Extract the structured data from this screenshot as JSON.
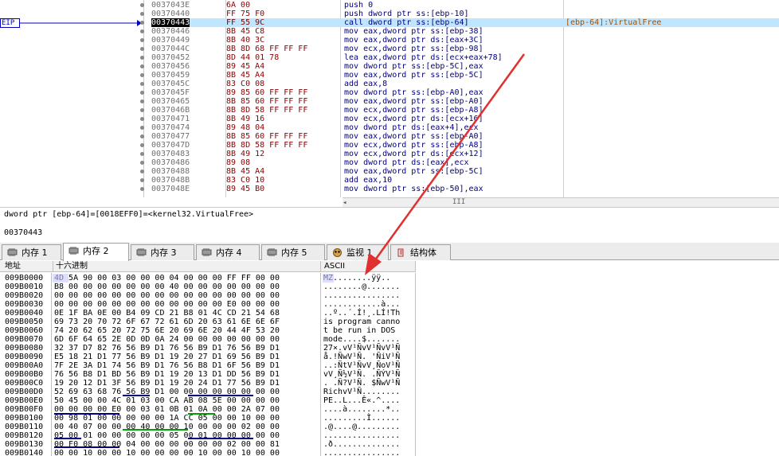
{
  "eip_label": "EIP",
  "disasm": [
    {
      "addr": "0037043E",
      "bytes": "6A 00",
      "ins": "push 0",
      "cm": ""
    },
    {
      "addr": "00370440",
      "bytes": "FF 75 F0",
      "ins": "push dword ptr ss:[ebp-10]",
      "cm": ""
    },
    {
      "addr": "00370443",
      "bytes": "FF 55 9C",
      "ins": "call dword ptr ss:[ebp-64]",
      "cm": "[ebp-64]:VirtualFree",
      "cur": true
    },
    {
      "addr": "00370446",
      "bytes": "8B 45 C8",
      "ins": "mov eax,dword ptr ss:[ebp-38]",
      "cm": ""
    },
    {
      "addr": "00370449",
      "bytes": "8B 40 3C",
      "ins": "mov eax,dword ptr ds:[eax+3C]",
      "cm": ""
    },
    {
      "addr": "0037044C",
      "bytes": "8B 8D 68 FF FF FF",
      "ins": "mov ecx,dword ptr ss:[ebp-98]",
      "cm": ""
    },
    {
      "addr": "00370452",
      "bytes": "8D 44 01 78",
      "ins": "lea eax,dword ptr ds:[ecx+eax+78]",
      "cm": ""
    },
    {
      "addr": "00370456",
      "bytes": "89 45 A4",
      "ins": "mov dword ptr ss:[ebp-5C],eax",
      "cm": ""
    },
    {
      "addr": "00370459",
      "bytes": "8B 45 A4",
      "ins": "mov eax,dword ptr ss:[ebp-5C]",
      "cm": ""
    },
    {
      "addr": "0037045C",
      "bytes": "83 C0 08",
      "ins": "add eax,8",
      "cm": ""
    },
    {
      "addr": "0037045F",
      "bytes": "89 85 60 FF FF FF",
      "ins": "mov dword ptr ss:[ebp-A0],eax",
      "cm": ""
    },
    {
      "addr": "00370465",
      "bytes": "8B 85 60 FF FF FF",
      "ins": "mov eax,dword ptr ss:[ebp-A0]",
      "cm": ""
    },
    {
      "addr": "0037046B",
      "bytes": "8B 8D 58 FF FF FF",
      "ins": "mov ecx,dword ptr ss:[ebp-A8]",
      "cm": ""
    },
    {
      "addr": "00370471",
      "bytes": "8B 49 16",
      "ins": "mov ecx,dword ptr ds:[ecx+16]",
      "cm": ""
    },
    {
      "addr": "00370474",
      "bytes": "89 48 04",
      "ins": "mov dword ptr ds:[eax+4],ecx",
      "cm": ""
    },
    {
      "addr": "00370477",
      "bytes": "8B 85 60 FF FF FF",
      "ins": "mov eax,dword ptr ss:[ebp-A0]",
      "cm": ""
    },
    {
      "addr": "0037047D",
      "bytes": "8B 8D 58 FF FF FF",
      "ins": "mov ecx,dword ptr ss:[ebp-A8]",
      "cm": ""
    },
    {
      "addr": "00370483",
      "bytes": "8B 49 12",
      "ins": "mov ecx,dword ptr ds:[ecx+12]",
      "cm": ""
    },
    {
      "addr": "00370486",
      "bytes": "89 08",
      "ins": "mov dword ptr ds:[eax],ecx",
      "cm": ""
    },
    {
      "addr": "00370488",
      "bytes": "8B 45 A4",
      "ins": "mov eax,dword ptr ss:[ebp-5C]",
      "cm": ""
    },
    {
      "addr": "0037048B",
      "bytes": "83 C0 10",
      "ins": "add eax,10",
      "cm": ""
    },
    {
      "addr": "0037048E",
      "bytes": "89 45 B0",
      "ins": "mov dword ptr ss:[ebp-50],eax",
      "cm": ""
    }
  ],
  "scroll_marker": "III",
  "info_line1": "dword ptr [ebp-64]=[0018EFF0]=<kernel32.VirtualFree>",
  "info_line2": "00370443",
  "tabs": [
    {
      "label": "内存 1",
      "active": false,
      "icon": "memory-icon"
    },
    {
      "label": "内存 2",
      "active": true,
      "icon": "memory-icon"
    },
    {
      "label": "内存 3",
      "active": false,
      "icon": "memory-icon"
    },
    {
      "label": "内存 4",
      "active": false,
      "icon": "memory-icon"
    },
    {
      "label": "内存 5",
      "active": false,
      "icon": "memory-icon"
    },
    {
      "label": "监视 1",
      "active": false,
      "icon": "watch-icon"
    },
    {
      "label": "结构体",
      "active": false,
      "icon": "struct-icon"
    }
  ],
  "hex_headers": {
    "addr": "地址",
    "hex": "十六进制",
    "ascii": "ASCII"
  },
  "hex_rows": [
    {
      "a": "009B0000",
      "b": "4D 5A 90 00 03 00 00 00 04 00 00 00 FF FF 00 00",
      "s": "MZ........ÿÿ.."
    },
    {
      "a": "009B0010",
      "b": "B8 00 00 00 00 00 00 00 40 00 00 00 00 00 00 00",
      "s": "........@......."
    },
    {
      "a": "009B0020",
      "b": "00 00 00 00 00 00 00 00 00 00 00 00 00 00 00 00",
      "s": "................"
    },
    {
      "a": "009B0030",
      "b": "00 00 00 00 00 00 00 00 00 00 00 00 E0 00 00 00",
      "s": "............à..."
    },
    {
      "a": "009B0040",
      "b": "0E 1F BA 0E 00 B4 09 CD 21 B8 01 4C CD 21 54 68",
      "s": "..º..´.Í!¸.LÍ!Th"
    },
    {
      "a": "009B0050",
      "b": "69 73 20 70 72 6F 67 72 61 6D 20 63 61 6E 6E 6F",
      "s": "is program canno"
    },
    {
      "a": "009B0060",
      "b": "74 20 62 65 20 72 75 6E 20 69 6E 20 44 4F 53 20",
      "s": "t be run in DOS "
    },
    {
      "a": "009B0070",
      "b": "6D 6F 64 65 2E 0D 0D 0A 24 00 00 00 00 00 00 00",
      "s": "mode....$......."
    },
    {
      "a": "009B0080",
      "b": "32 37 D7 82 76 56 B9 D1 76 56 B9 D1 76 56 B9 D1",
      "s": "27×.vV¹ÑvV¹ÑvV¹Ñ"
    },
    {
      "a": "009B0090",
      "b": "E5 18 21 D1 77 56 B9 D1 19 20 27 D1 69 56 B9 D1",
      "s": "å.!ÑwV¹Ñ. 'ÑiV¹Ñ"
    },
    {
      "a": "009B00A0",
      "b": "7F 2E 3A D1 74 56 B9 D1 76 56 B8 D1 6F 56 B9 D1",
      "s": "..:ÑtV¹ÑvV¸ÑoV¹Ñ"
    },
    {
      "a": "009B00B0",
      "b": "76 56 B8 D1 BD 56 B9 D1 19 20 13 D1 DD 56 B9 D1",
      "s": "vV¸Ñ½V¹Ñ. .ÑÝV¹Ñ"
    },
    {
      "a": "009B00C0",
      "b": "19 20 12 D1 3F 56 B9 D1 19 20 24 D1 77 56 B9 D1",
      "s": ". .Ñ?V¹Ñ. $ÑwV¹Ñ"
    },
    {
      "a": "009B00D0",
      "b": "52 69 63 68 76 56 B9 D1 00 00 00 00 00 00 00 00",
      "s": "RichvV¹Ñ........"
    },
    {
      "a": "009B00E0",
      "b": "50 45 00 00 4C 01 03 00 CA AB 08 5E 00 00 00 00",
      "s": "PE..L...Ê«.^...."
    },
    {
      "a": "009B00F0",
      "b": "00 00 00 00 E0 00 03 01 0B 01 0A 00 00 2A 07 00",
      "s": "....à........*.."
    },
    {
      "a": "009B0100",
      "b": "00 98 01 00 00 00 00 00 1A CC 05 00 00 10 00 00",
      "s": ".........Ì......"
    },
    {
      "a": "009B0110",
      "b": "00 40 07 00 00 00 40 00 00 10 00 00 00 02 00 00",
      "s": ".@....@........."
    },
    {
      "a": "009B0120",
      "b": "05 00 01 00 00 00 00 00 05 00 01 00 00 00 00 00",
      "s": "................"
    },
    {
      "a": "009B0130",
      "b": "00 F0 08 00 00 04 00 00 00 00 00 00 02 00 00 81",
      "s": ".ð.............."
    },
    {
      "a": "009B0140",
      "b": "00 00 10 00 00 10 00 00 00 00 10 00 00 10 00 00",
      "s": "................"
    }
  ]
}
